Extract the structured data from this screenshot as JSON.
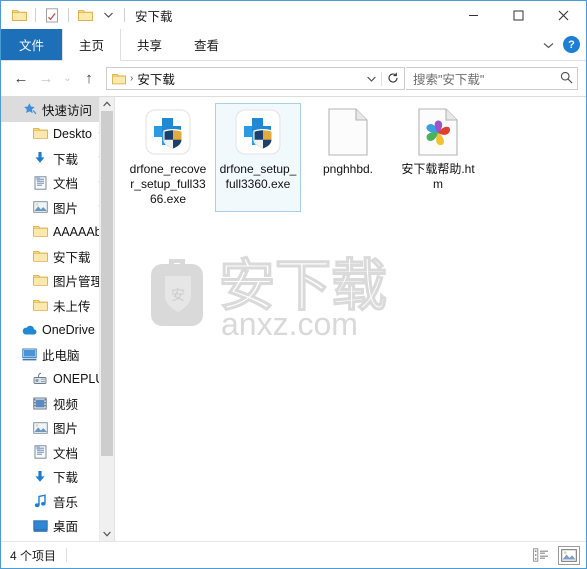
{
  "window": {
    "title": "安下载",
    "quick_access": [
      {
        "name": "folder-icon",
        "label": "属性"
      },
      {
        "name": "properties-icon",
        "label": "属性"
      },
      {
        "name": "new-folder-icon",
        "label": "新建文件夹"
      },
      {
        "name": "chevron-down-icon",
        "label": "自定义快速访问工具栏"
      }
    ],
    "controls": {
      "minimize": "—",
      "maximize": "▢",
      "close": "✕"
    }
  },
  "ribbon": {
    "tabs": [
      {
        "label": "文件",
        "state": "file"
      },
      {
        "label": "主页",
        "state": "active"
      },
      {
        "label": "共享",
        "state": "normal"
      },
      {
        "label": "查看",
        "state": "normal"
      }
    ],
    "expand_label": "⌄",
    "help_label": "?"
  },
  "addressbar": {
    "back": "←",
    "forward": "→",
    "history": "⌄",
    "up": "↑",
    "breadcrumb_sep": "›",
    "path": "安下载",
    "dropdown": "⌄",
    "refresh": "↻"
  },
  "search": {
    "placeholder": "搜索\"安下载\"",
    "icon": "search-icon"
  },
  "sidebar": {
    "items": [
      {
        "label": "快速访问",
        "icon": "star-pin-icon",
        "level": 0,
        "selected": true,
        "pinned": false
      },
      {
        "label": "Deskto",
        "icon": "folder-icon",
        "level": 1,
        "selected": false,
        "pinned": true
      },
      {
        "label": "下载",
        "icon": "download-icon",
        "level": 1,
        "selected": false,
        "pinned": true
      },
      {
        "label": "文档",
        "icon": "documents-icon",
        "level": 1,
        "selected": false,
        "pinned": true
      },
      {
        "label": "图片",
        "icon": "pictures-icon",
        "level": 1,
        "selected": false,
        "pinned": true
      },
      {
        "label": "AAAAAbbl",
        "icon": "folder-icon",
        "level": 1,
        "selected": false,
        "pinned": false
      },
      {
        "label": "安下载",
        "icon": "folder-icon",
        "level": 1,
        "selected": false,
        "pinned": false
      },
      {
        "label": "图片管理器",
        "icon": "folder-icon",
        "level": 1,
        "selected": false,
        "pinned": false
      },
      {
        "label": "未上传",
        "icon": "folder-icon",
        "level": 1,
        "selected": false,
        "pinned": false
      },
      {
        "label": "OneDrive",
        "icon": "onedrive-icon",
        "level": 0,
        "selected": false,
        "pinned": false
      },
      {
        "label": "此电脑",
        "icon": "thispc-icon",
        "level": 0,
        "selected": false,
        "pinned": false
      },
      {
        "label": "ONEPLUS",
        "icon": "phone-icon",
        "level": 1,
        "selected": false,
        "pinned": false
      },
      {
        "label": "视频",
        "icon": "videos-icon",
        "level": 1,
        "selected": false,
        "pinned": false
      },
      {
        "label": "图片",
        "icon": "pictures-icon",
        "level": 1,
        "selected": false,
        "pinned": false
      },
      {
        "label": "文档",
        "icon": "documents-icon",
        "level": 1,
        "selected": false,
        "pinned": false
      },
      {
        "label": "下载",
        "icon": "download-icon",
        "level": 1,
        "selected": false,
        "pinned": false
      },
      {
        "label": "音乐",
        "icon": "music-icon",
        "level": 1,
        "selected": false,
        "pinned": false
      },
      {
        "label": "桌面",
        "icon": "desktop-icon",
        "level": 1,
        "selected": false,
        "pinned": false
      }
    ],
    "scroll_up": "⌃",
    "scroll_down": "⌄"
  },
  "files": [
    {
      "name": "drfone_recover_setup_full3366.exe",
      "icon": "drfone-app-icon",
      "selected": false
    },
    {
      "name": "drfone_setup_full3360.exe",
      "icon": "drfone-app-icon",
      "selected": true
    },
    {
      "name": "pnghhbd.",
      "icon": "blank-document-icon",
      "selected": false
    },
    {
      "name": "安下载帮助.htm",
      "icon": "html-360browser-icon",
      "selected": false
    }
  ],
  "watermark": {
    "brand": "安下载",
    "domain": "anxz.com",
    "mark": "安"
  },
  "statusbar": {
    "item_count": "4 个项目",
    "views": [
      {
        "name": "details-view-button",
        "active": false
      },
      {
        "name": "large-icons-view-button",
        "active": true
      }
    ]
  },
  "colors": {
    "accent": "#1d6fb8",
    "selection_border": "#a9cfe8",
    "selection_fill": "#f2f9fd",
    "folder_yellow": "#fbd978",
    "watermark_gray": "#d8d8d8"
  }
}
